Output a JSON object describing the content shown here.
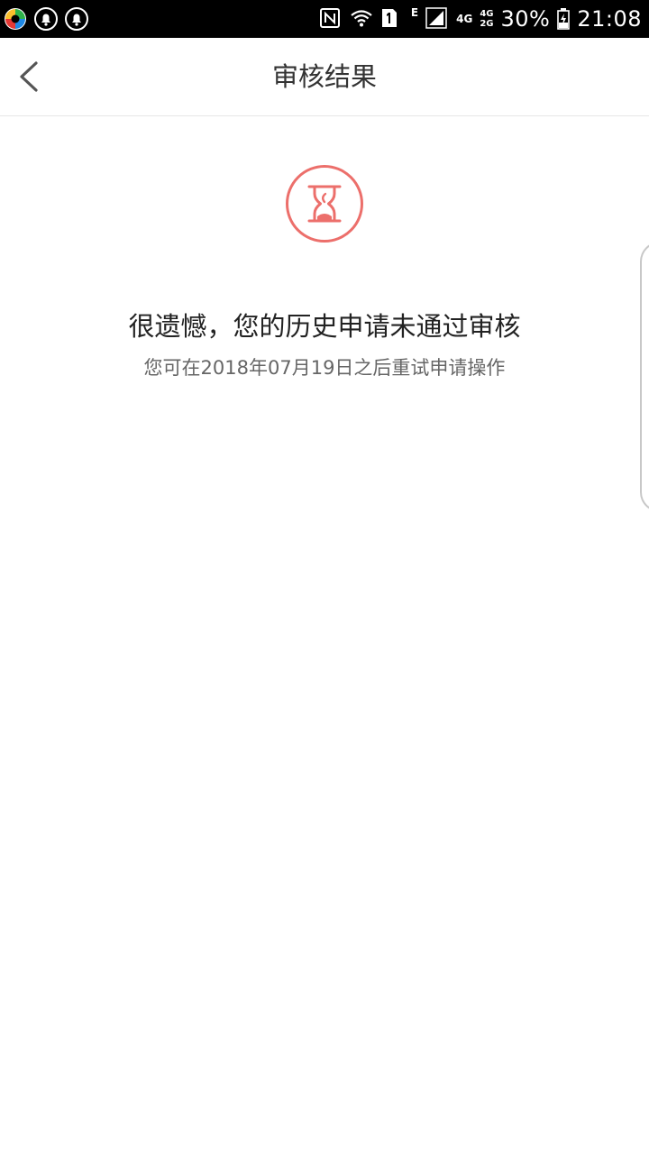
{
  "status_bar": {
    "left_icons": [
      "app-logo-icon",
      "notification-bell-icon",
      "notification-bell-icon"
    ],
    "right_icons": [
      "nfc-icon",
      "wifi-icon",
      "sim1-icon",
      "signal-icon",
      "battery-charging-icon"
    ],
    "network_e": "E",
    "network_4g": "4G",
    "network_4g_2": "4G",
    "network_2g": "2G",
    "battery": "30%",
    "time": "21:08"
  },
  "nav": {
    "back_icon": "chevron-left-icon",
    "title": "审核结果"
  },
  "result": {
    "icon": "hourglass-icon",
    "accent_color": "#EC6F6B",
    "title": "很遗憾，您的历史申请未通过审核",
    "description": "您可在2018年07月19日之后重试申请操作"
  }
}
